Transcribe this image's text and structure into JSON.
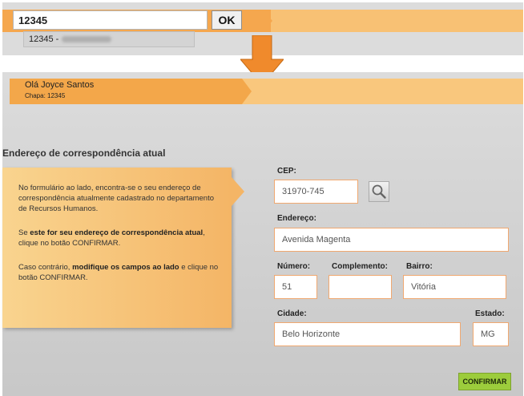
{
  "login": {
    "input_value": "12345",
    "ok_label": "OK",
    "suggestion_prefix": "12345 -"
  },
  "header": {
    "greeting": "Olá Joyce Santos",
    "badge_id": "Chapa: 12345"
  },
  "section": {
    "title": "Endereço de correspondência atual"
  },
  "info": {
    "p1": "No formulário ao lado, encontra-se o seu endereço de correspondência atualmente cadastrado no departamento de Recursos Humanos.",
    "p2_pre": "Se ",
    "p2_bold": "este for seu endereço de correspondência atual",
    "p2_post": ", clique no botão CONFIRMAR.",
    "p3_pre": "Caso contrário, ",
    "p3_bold": "modifique os campos ao lado",
    "p3_post": " e clique no botão CONFIRMAR."
  },
  "form": {
    "cep_label": "CEP:",
    "cep_value": "31970-745",
    "endereco_label": "Endereço:",
    "endereco_value": "Avenida Magenta",
    "numero_label": "Número:",
    "numero_value": "51",
    "complemento_label": "Complemento:",
    "complemento_value": "",
    "bairro_label": "Bairro:",
    "bairro_value": "Vitória",
    "cidade_label": "Cidade:",
    "cidade_value": "Belo Horizonte",
    "estado_label": "Estado:",
    "estado_value": "MG",
    "confirm_label": "CONFIRMAR"
  },
  "icons": {
    "lookup": "magnifier-icon",
    "transition": "down-arrow-icon"
  },
  "colors": {
    "accent_orange": "#f3a74a",
    "accent_light": "#f9c77d",
    "confirm_green": "#9ccc3c"
  }
}
